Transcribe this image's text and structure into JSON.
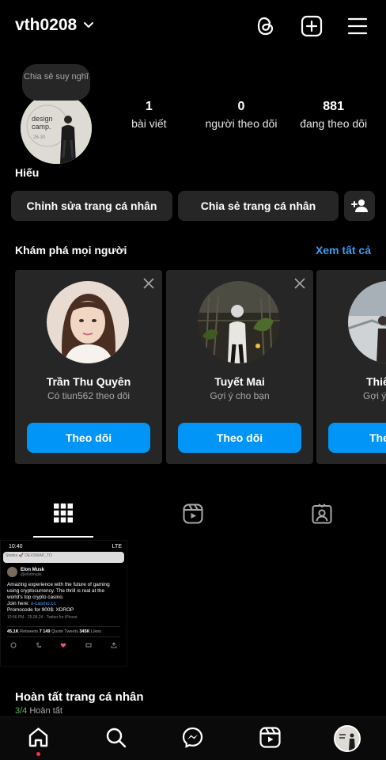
{
  "header": {
    "username": "vth0208",
    "icons": [
      "chevron-down-icon",
      "threads-icon",
      "plus-square-icon",
      "menu-icon"
    ]
  },
  "profile": {
    "note": "Chia sẻ suy nghĩ",
    "avatar_text": [
      "design",
      "camp.",
      "26-30"
    ],
    "stats": [
      {
        "num": "1",
        "label": "bài viết"
      },
      {
        "num": "0",
        "label": "người theo dõi"
      },
      {
        "num": "881",
        "label": "đang theo dõi"
      }
    ],
    "name": "Hiếu",
    "edit_label": "Chỉnh sửa trang cá nhân",
    "share_label": "Chia sẻ trang cá nhân"
  },
  "discover": {
    "title": "Khám phá mọi người",
    "see_all": "Xem tất cả",
    "cards": [
      {
        "name": "Trần Thu Quyên",
        "sub": "Có tiun562 theo dõi",
        "button": "Theo dõi"
      },
      {
        "name": "Tuyết Mai",
        "sub": "Gợi ý cho bạn",
        "button": "Theo dõi"
      },
      {
        "name": "Thiê",
        "sub": "Gợi ý",
        "button": "The"
      }
    ]
  },
  "tabs": [
    "grid-icon",
    "reels-icon",
    "tagged-icon"
  ],
  "post": {
    "status_time": "10:40",
    "status_net": "LTE",
    "notif_text": "Stonks 🚀 DEXSWAP_TO",
    "author": "Elon Musk",
    "handle": "@elonmusk",
    "body": "Amazing experience with the future of gaming using cryptocurrency. The thrill is real at the world's top crypto casino.",
    "join": "Join here:",
    "link": "x-casino.cc",
    "promo": "Promocode for 900$: XDROP",
    "time": "10:56 PM · 25.08.24 · Twitter for iPhone",
    "retweets_num": "45,1K",
    "retweets_lbl": "Retweets",
    "quotes_num": "7 149",
    "quotes_lbl": "Quote Tweets",
    "likes_num": "345K",
    "likes_lbl": "Likes"
  },
  "complete": {
    "title": "Hoàn tất trang cá nhân",
    "progress": "3/4",
    "done": "Hoàn tất"
  },
  "bottom_nav": [
    "home-icon",
    "search-icon",
    "messenger-icon",
    "reels-icon",
    "profile-avatar"
  ],
  "colors": {
    "accent": "#0095f6",
    "link": "#3d9cf0",
    "card_bg": "#262626",
    "badge": "#ff3040"
  }
}
